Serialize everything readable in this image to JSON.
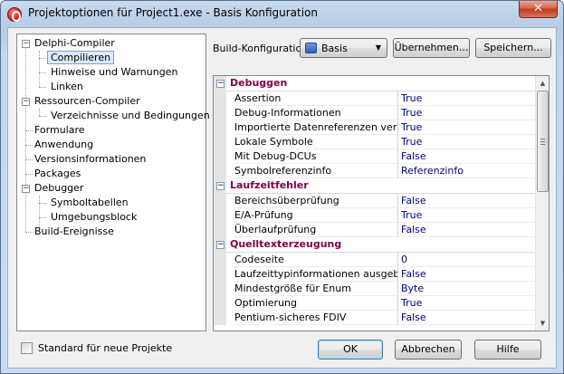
{
  "window": {
    "title": "Projektoptionen für Project1.exe - Basis Konfiguration",
    "close_glyph": "✕"
  },
  "tree": {
    "items": [
      {
        "label": "Delphi-Compiler",
        "expanded": true
      },
      {
        "label": "Compilieren",
        "selected": true
      },
      {
        "label": "Hinweise und Warnungen"
      },
      {
        "label": "Linken"
      },
      {
        "label": "Ressourcen-Compiler",
        "expanded": true
      },
      {
        "label": "Verzeichnisse und Bedingungen"
      },
      {
        "label": "Formulare"
      },
      {
        "label": "Anwendung"
      },
      {
        "label": "Versionsinformationen"
      },
      {
        "label": "Packages"
      },
      {
        "label": "Debugger",
        "expanded": true
      },
      {
        "label": "Symboltabellen"
      },
      {
        "label": "Umgebungsblock"
      },
      {
        "label": "Build-Ereignisse"
      }
    ]
  },
  "build": {
    "label": "Build-Konfiguration",
    "selected": "Basis",
    "apply_label": "Übernehmen...",
    "save_label": "Speichern..."
  },
  "grid": {
    "categories": [
      {
        "name": "Debuggen",
        "props": [
          {
            "name": "Assertion",
            "value": "True"
          },
          {
            "name": "Debug-Informationen",
            "value": "True"
          },
          {
            "name": "Importierte Datenreferenzen verwenden",
            "value": "True"
          },
          {
            "name": "Lokale Symbole",
            "value": "True"
          },
          {
            "name": "Mit Debug-DCUs",
            "value": "False"
          },
          {
            "name": "Symbolreferenzinfo",
            "value": "Referenzinfo"
          }
        ]
      },
      {
        "name": "Laufzeitfehler",
        "props": [
          {
            "name": "Bereichsüberprüfung",
            "value": "False"
          },
          {
            "name": "E/A-Prüfung",
            "value": "True"
          },
          {
            "name": "Überlaufprüfung",
            "value": "False"
          }
        ]
      },
      {
        "name": "Quelltexterzeugung",
        "props": [
          {
            "name": "Codeseite",
            "value": "0"
          },
          {
            "name": "Laufzeittypinformationen ausgeben",
            "value": "False"
          },
          {
            "name": "Mindestgröße für Enum",
            "value": "Byte"
          },
          {
            "name": "Optimierung",
            "value": "True"
          },
          {
            "name": "Pentium-sicheres FDIV",
            "value": "False"
          }
        ]
      }
    ]
  },
  "footer": {
    "checkbox_label": "Standard für neue Projekte",
    "checkbox_checked": false,
    "ok_label": "OK",
    "cancel_label": "Abbrechen",
    "help_label": "Hilfe"
  }
}
